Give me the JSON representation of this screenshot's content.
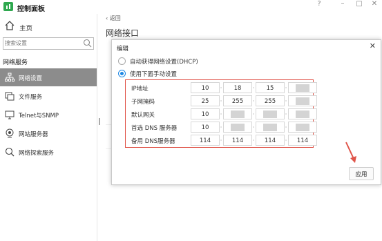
{
  "app": {
    "title": "控制面板",
    "win_help": "?",
    "win_min": "–",
    "win_max": "□",
    "win_close": "✕"
  },
  "sidebar": {
    "home_label": "主页",
    "search_placeholder": "搜索设置",
    "section_label": "网络服务",
    "items": [
      {
        "label": "网络设置",
        "icon": "network-icon",
        "active": true
      },
      {
        "label": "文件服务",
        "icon": "file-service-icon",
        "active": false
      },
      {
        "label": "Telnet与SNMP",
        "icon": "monitor-icon",
        "active": false
      },
      {
        "label": "网站服务器",
        "icon": "globe-icon",
        "active": false
      },
      {
        "label": "网络探索服务",
        "icon": "search-icon",
        "active": false
      }
    ]
  },
  "main": {
    "back_label": "返回",
    "page_title": "网络接口"
  },
  "dialog": {
    "title": "编辑",
    "close": "✕",
    "radio_dhcp": "自动获得网络设置(DHCP)",
    "radio_manual": "使用下面手动设置",
    "rows": [
      {
        "label": "IP地址",
        "octets": [
          "10",
          "18",
          "15",
          ""
        ]
      },
      {
        "label": "子网掩码",
        "octets": [
          "25",
          "255",
          "255",
          ""
        ]
      },
      {
        "label": "默认网关",
        "octets": [
          "10",
          "",
          "",
          ""
        ]
      },
      {
        "label": "首选 DNS 服务器",
        "octets": [
          "10",
          "",
          "",
          ""
        ]
      },
      {
        "label": "备用 DNS服务器",
        "octets": [
          "114",
          "114",
          "114",
          "114"
        ]
      }
    ],
    "apply_label": "应用"
  },
  "colors": {
    "accent": "#1e88e5",
    "highlight_box": "#e0554a",
    "active_nav": "#8c8c8c",
    "brand": "#2fa84f"
  }
}
